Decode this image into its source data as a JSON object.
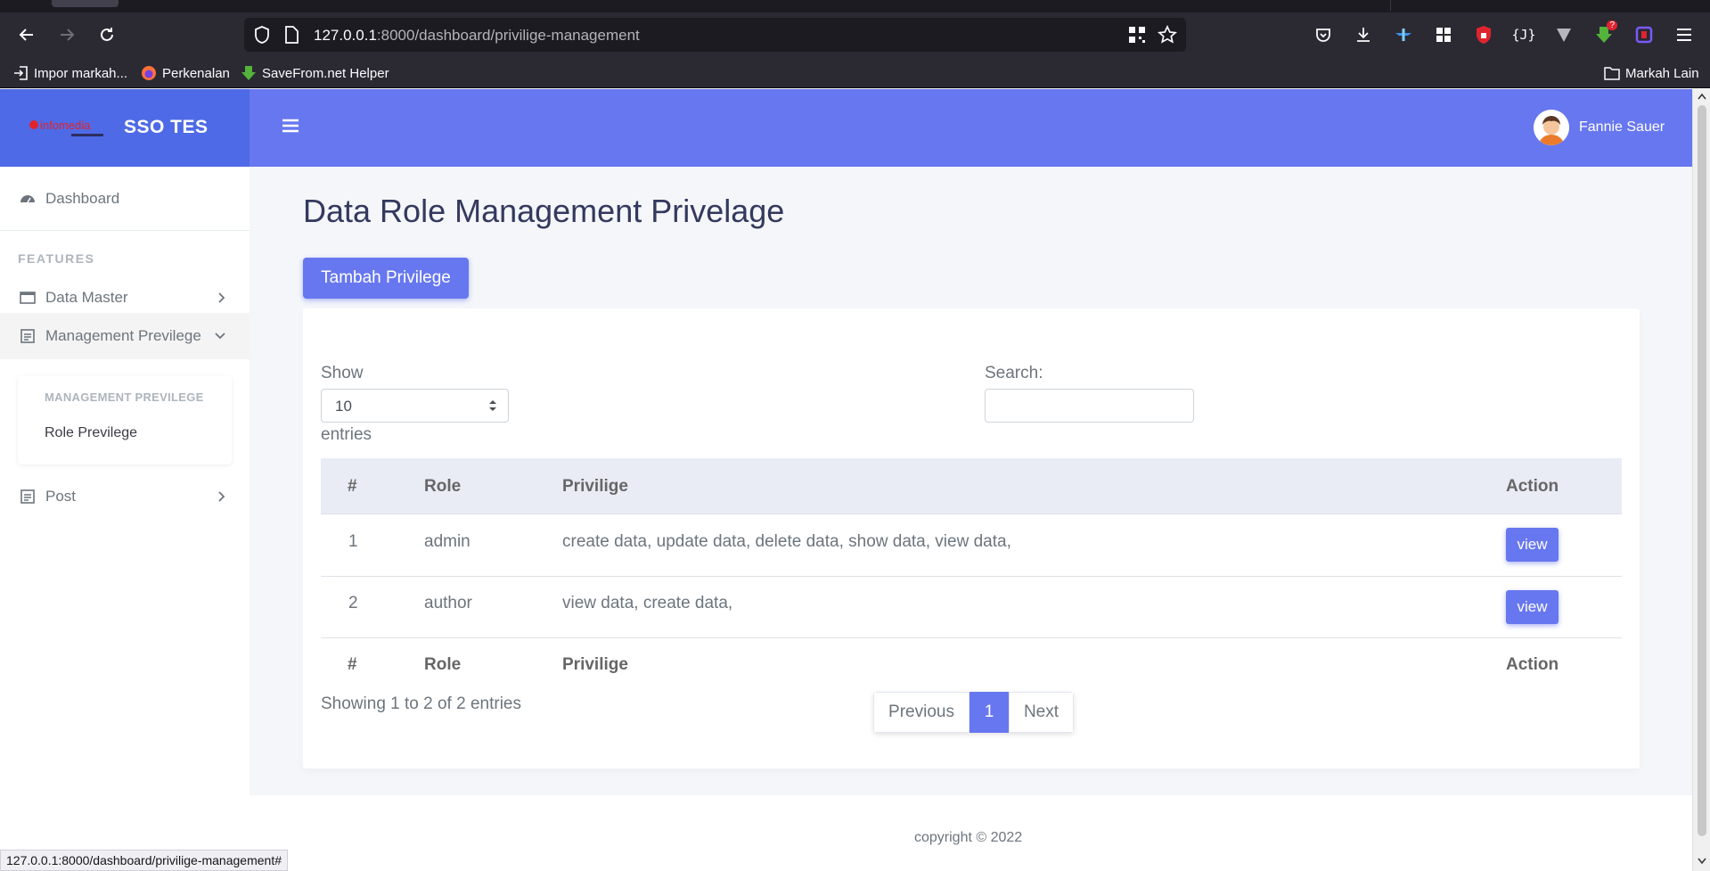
{
  "browser": {
    "url_host": "127.0.0.1",
    "url_rest": ":8000/dashboard/privilige-management",
    "bookmarks": [
      "Impor markah...",
      "Perkenalan",
      "SaveFrom.net Helper"
    ],
    "other_bookmarks": "Markah Lain",
    "status_url": "127.0.0.1:8000/dashboard/privilige-management#",
    "ext_badge": "?"
  },
  "app": {
    "brand_title": "SSO TES",
    "brand_logo_text": "infomedia",
    "user_name": "Fannie Sauer",
    "accent": "#6777ef"
  },
  "sidebar": {
    "dashboard": "Dashboard",
    "features_header": "FEATURES",
    "data_master": "Data Master",
    "management_privilege": "Management Previlege",
    "submenu_header": "MANAGEMENT PREVILEGE",
    "role_privilege": "Role Previlege",
    "post": "Post"
  },
  "main": {
    "page_title": "Data Role Management Privelage",
    "add_button": "Tambah Privilege",
    "show_label": "Show",
    "entries_label": "entries",
    "page_length": "10",
    "search_label": "Search:",
    "search_value": "",
    "columns": [
      "#",
      "Role",
      "Privilige",
      "Action"
    ],
    "rows": [
      {
        "no": "1",
        "role": "admin",
        "privilege": "create data, update data, delete data, show data, view data,",
        "action": "view"
      },
      {
        "no": "2",
        "role": "author",
        "privilege": "view data, create data,",
        "action": "view"
      }
    ],
    "info": "Showing 1 to 2 of 2 entries",
    "pagination": {
      "previous": "Previous",
      "current": "1",
      "next": "Next"
    }
  },
  "footer": {
    "copyright": "copyright © 2022"
  }
}
